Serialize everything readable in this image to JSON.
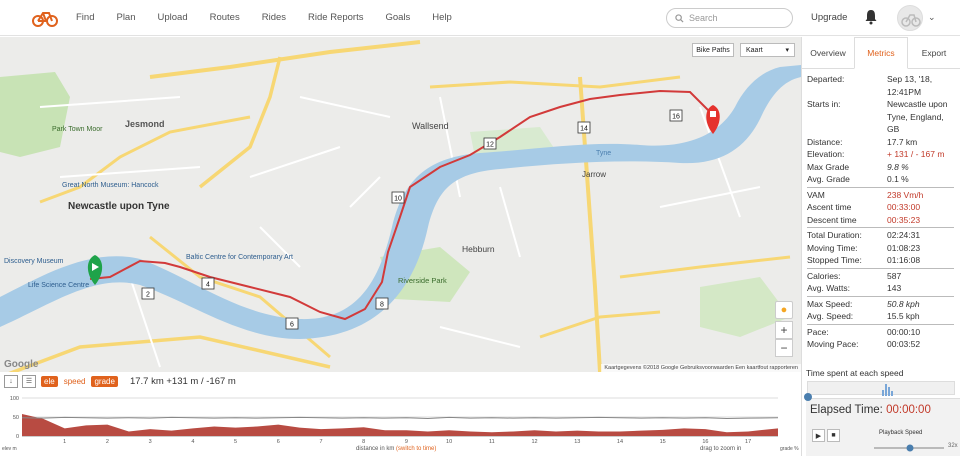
{
  "nav": {
    "items": [
      "Find",
      "Plan",
      "Upload",
      "Routes",
      "Rides",
      "Ride Reports",
      "Goals",
      "Help"
    ],
    "search_placeholder": "Search",
    "upgrade": "Upgrade"
  },
  "map": {
    "layer_button": "Bike Paths",
    "map_type": "Kaart",
    "zoom_in": "+",
    "zoom_out": "−",
    "google_logo": "Google",
    "attribution": "Kaartgegevens ©2018 Google    Gebruiksvoorwaarden    Een kaartfout rapporteren",
    "places": [
      "Jesmond",
      "Wallsend",
      "Newcastle upon Tyne",
      "Hebburn",
      "Jarrow",
      "Riverside Park",
      "Great North Museum: Hancock",
      "Life Science Centre",
      "Discovery Museum",
      "Baltic Centre for Contemporary Art",
      "Park Town Moor",
      "Tyne"
    ],
    "markers": [
      "2",
      "4",
      "6",
      "8",
      "10",
      "12",
      "14",
      "16"
    ],
    "route_color": "#d23a3a",
    "river_color": "#a7cbe6"
  },
  "tabs": [
    "Overview",
    "Metrics",
    "Export"
  ],
  "metrics": [
    {
      "k": "Departed:",
      "v": "Sep 13, '18, 12:41PM"
    },
    {
      "k": "Starts in:",
      "v": "Newcastle upon Tyne, England, GB"
    },
    {
      "k": "Distance:",
      "v": "17.7 km"
    },
    {
      "k": "Elevation:",
      "v": "+ 131 / - 167 m",
      "red": true
    },
    {
      "k": "Max Grade",
      "v": "9.8 %",
      "it": true
    },
    {
      "k": "Avg. Grade",
      "v": "0.1 %"
    },
    {
      "sep": true
    },
    {
      "k": "VAM",
      "v": "238 Vm/h",
      "red": true
    },
    {
      "k": "Ascent time",
      "v": "00:33:00",
      "red": true
    },
    {
      "k": "Descent time",
      "v": "00:35:23",
      "red": true
    },
    {
      "sep": true
    },
    {
      "k": "Total Duration:",
      "v": "02:24:31"
    },
    {
      "k": "Moving Time:",
      "v": "01:08:23"
    },
    {
      "k": "Stopped Time:",
      "v": "01:16:08"
    },
    {
      "sep": true
    },
    {
      "k": "Calories:",
      "v": "587"
    },
    {
      "k": "Avg. Watts:",
      "v": "143"
    },
    {
      "sep": true
    },
    {
      "k": "Max Speed:",
      "v": "50.8 kph",
      "it": true
    },
    {
      "k": "Avg. Speed:",
      "v": "15.5 kph"
    },
    {
      "sep": true
    },
    {
      "k": "Pace:",
      "v": "00:00:10"
    },
    {
      "k": "Moving Pace:",
      "v": "00:03:52"
    }
  ],
  "time_spent": "Time spent at each speed",
  "elapsed": {
    "label": "Elapsed Time:",
    "value": "00:00:00"
  },
  "playback": {
    "label": "Playback Speed",
    "value": "32x"
  },
  "chart": {
    "toggles": [
      "ele",
      "speed",
      "grade"
    ],
    "summary": "17.7 km +131 m / -167 m",
    "xlabel": "distance in km",
    "xlabel_link": "(switch to time)",
    "hint": "drag to zoom in",
    "left_label": "elev m",
    "right_label": "grade %"
  },
  "chart_data": {
    "type": "area",
    "x": [
      0,
      0.5,
      1,
      1.5,
      2,
      2.5,
      3,
      3.5,
      4,
      4.5,
      5,
      5.5,
      6,
      6.5,
      7,
      7.5,
      8,
      8.5,
      9,
      9.5,
      10,
      10.5,
      11,
      11.5,
      12,
      12.5,
      13,
      13.5,
      14,
      14.5,
      15,
      15.5,
      16,
      16.5,
      17,
      17.7
    ],
    "series": [
      {
        "values": [
          58,
          45,
          20,
          28,
          30,
          12,
          18,
          14,
          20,
          25,
          22,
          25,
          30,
          22,
          18,
          20,
          23,
          15,
          15,
          12,
          15,
          12,
          10,
          12,
          15,
          12,
          14,
          12,
          12,
          14,
          16,
          20,
          18,
          10,
          12,
          20
        ]
      },
      {
        "values": [
          48,
          47,
          49,
          48,
          47,
          48,
          47,
          49,
          48,
          47,
          48,
          47,
          48,
          49,
          48,
          47,
          48,
          47,
          48,
          46,
          49,
          47,
          48,
          47,
          48,
          47,
          48,
          49,
          48,
          47,
          48,
          47,
          48,
          46,
          47,
          48
        ]
      }
    ],
    "xticks": [
      "1",
      "2",
      "3",
      "4",
      "5",
      "6",
      "7",
      "8",
      "9",
      "10",
      "11",
      "12",
      "13",
      "14",
      "15",
      "16",
      "17"
    ],
    "yticks": [
      "100",
      "50",
      "0"
    ],
    "ylim": [
      0,
      100
    ],
    "xlim": [
      0,
      17.7
    ]
  }
}
